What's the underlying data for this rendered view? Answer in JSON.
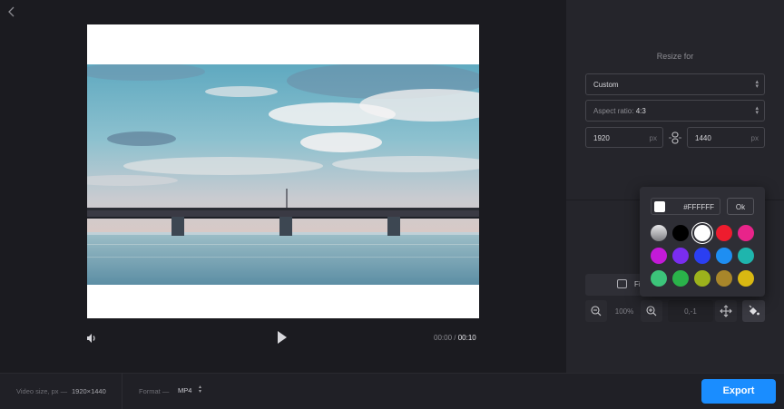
{
  "editor": {
    "time": {
      "current": "00:00",
      "separator": "/",
      "total": "00:10"
    },
    "canvas_background": "#FFFFFF"
  },
  "panel": {
    "resize_title": "Resize for",
    "resize_value": "Custom",
    "aspect_ratio_label": "Aspect ratio:",
    "aspect_ratio_value": "4:3",
    "width_value": "1920",
    "height_value": "1440",
    "unit": "px",
    "fit_label": "Fi",
    "zoom_value": "100%",
    "position_value": "0,-1"
  },
  "color_picker": {
    "hex_value": "#FFFFFF",
    "ok_label": "Ok",
    "swatches": [
      {
        "name": "gradient",
        "color": "#b8b8b8"
      },
      {
        "name": "black",
        "color": "#000000"
      },
      {
        "name": "white",
        "color": "#ffffff"
      },
      {
        "name": "red",
        "color": "#ee1c2e"
      },
      {
        "name": "pink",
        "color": "#e8248a"
      },
      {
        "name": "magenta",
        "color": "#c41ad8"
      },
      {
        "name": "violet",
        "color": "#7a2df0"
      },
      {
        "name": "blue",
        "color": "#2b3ff2"
      },
      {
        "name": "sky-blue",
        "color": "#1e8ef2"
      },
      {
        "name": "teal",
        "color": "#1fb5ad"
      },
      {
        "name": "mint",
        "color": "#3cc47a"
      },
      {
        "name": "green",
        "color": "#2ab24a"
      },
      {
        "name": "olive",
        "color": "#9cb21c"
      },
      {
        "name": "bronze",
        "color": "#a8862a"
      },
      {
        "name": "yellow",
        "color": "#d9b812"
      }
    ]
  },
  "bottom_bar": {
    "video_size_label": "Video size, px —",
    "video_size_value": "1920×1440",
    "format_label": "Format —",
    "format_value": "MP4",
    "export_label": "Export"
  },
  "colors": {
    "accent": "#1a8dff",
    "panel": "#25252b",
    "background": "#1b1b20"
  }
}
